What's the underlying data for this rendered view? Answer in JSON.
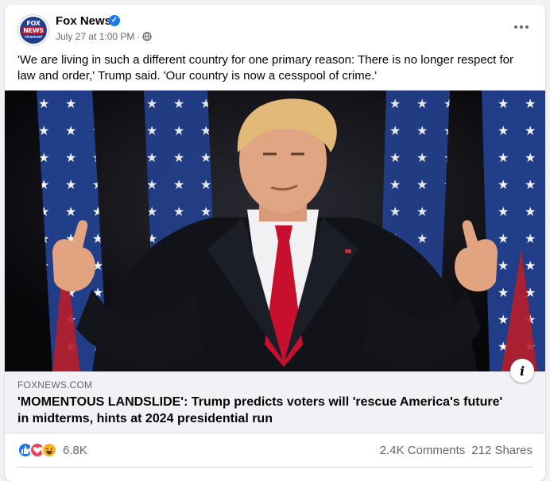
{
  "post": {
    "page_name": "Fox News",
    "avatar": {
      "line1": "FOX",
      "line2": "NEWS",
      "line3": "channel"
    },
    "timestamp": "July 27 at 1:00 PM",
    "meta_separator": "·",
    "verified_icon": "verified-badge-icon",
    "privacy_icon": "globe-icon",
    "text": "'We are living in such a different country for one primary reason: There is no longer respect for law and order,' Trump said. 'Our country is now a cesspool of crime.'"
  },
  "link_preview": {
    "domain": "FOXNEWS.COM",
    "title": "'MOMENTOUS LANDSLIDE': Trump predicts voters will 'rescue America's future' in midterms, hints at 2024 presidential run"
  },
  "engagement": {
    "reactions": [
      "like",
      "love",
      "haha"
    ],
    "reaction_count": "6.8K",
    "comments": "2.4K Comments",
    "shares": "212 Shares"
  },
  "colors": {
    "accent": "#1877f2",
    "background": "#f0f2f5",
    "secondary_text": "#65676b"
  }
}
